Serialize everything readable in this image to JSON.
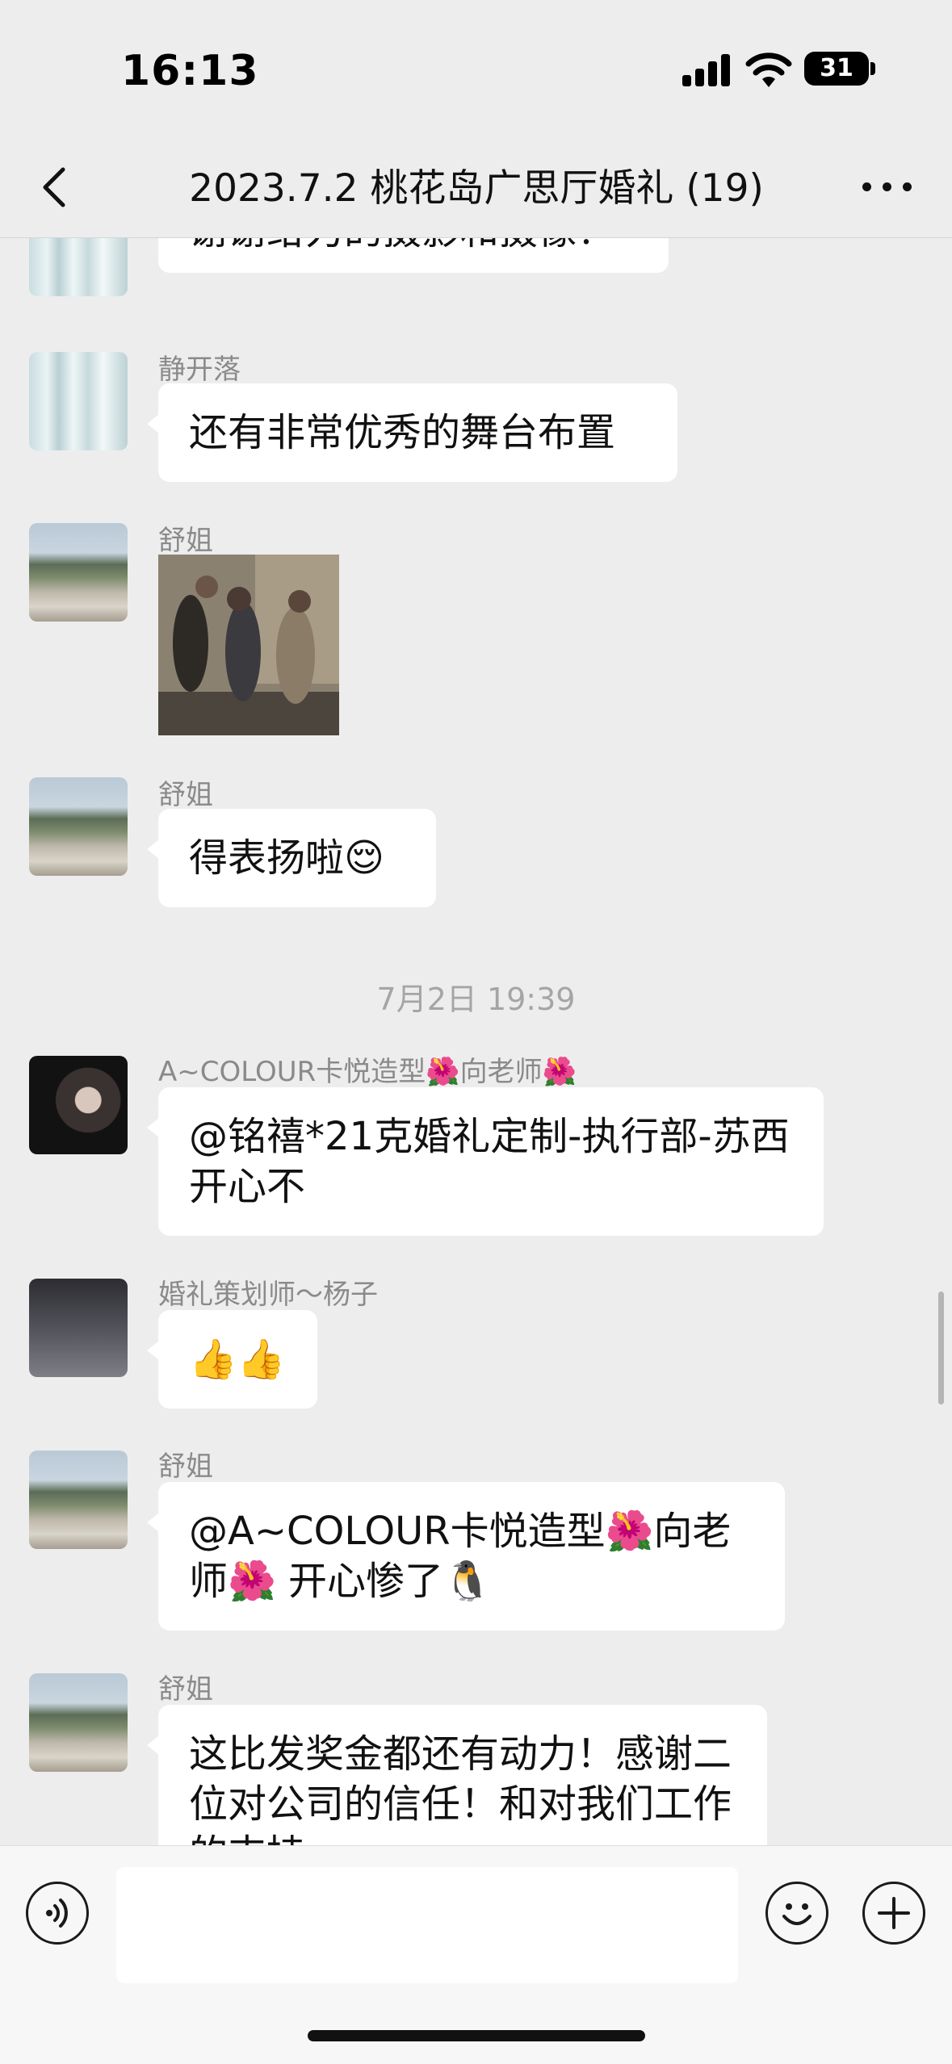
{
  "status": {
    "time": "16:13",
    "battery": "31"
  },
  "nav": {
    "title": "2023.7.2 桃花岛广思厅婚礼 (19)"
  },
  "messages": [
    {
      "sender": "",
      "text": "谢谢给力的摄影和摄像！"
    },
    {
      "sender": "静开落",
      "text": "还有非常优秀的舞台布置"
    },
    {
      "sender": "舒姐",
      "type": "gif"
    },
    {
      "sender": "舒姐",
      "text": "得表扬啦😌"
    },
    {
      "sender": "A~COLOUR卡悦造型🌺向老师🌺",
      "text": "@铭禧*21克婚礼定制-执行部-苏西 开心不"
    },
    {
      "sender": "婚礼策划师～杨子",
      "text": "👍👍"
    },
    {
      "sender": "舒姐",
      "text": "@A~COLOUR卡悦造型🌺向老师🌺 开心惨了🐧"
    },
    {
      "sender": "舒姐",
      "text": "这比发奖金都还有动力！感谢二位对公司的信任！和对我们工作的支持"
    }
  ],
  "timestamp": "7月2日 19:39",
  "icons": [
    "back-icon",
    "more-icon",
    "voice-icon",
    "emoji-icon",
    "add-icon"
  ]
}
